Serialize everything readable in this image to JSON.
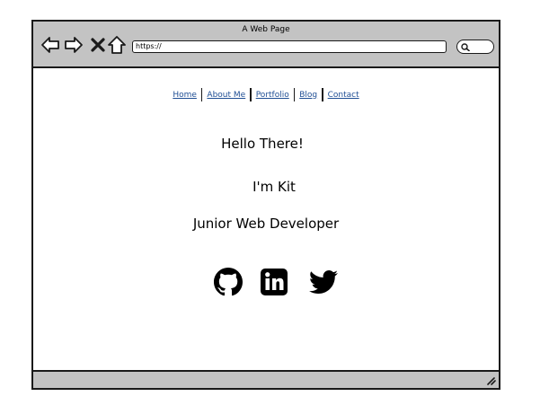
{
  "window": {
    "title": "A Web Page"
  },
  "toolbar": {
    "url": "https://",
    "icons": [
      "back-arrow-icon",
      "forward-arrow-icon",
      "stop-icon",
      "home-icon",
      "search-icon"
    ]
  },
  "nav": {
    "items": [
      {
        "label": "Home"
      },
      {
        "label": "About Me"
      },
      {
        "label": "Portfolio"
      },
      {
        "label": "Blog"
      },
      {
        "label": "Contact"
      }
    ],
    "link_color": "#1f4e94"
  },
  "main": {
    "greeting": "Hello There!",
    "name": "I'm Kit",
    "role": "Junior Web Developer"
  },
  "social": {
    "icons": [
      "github-icon",
      "linkedin-icon",
      "twitter-icon"
    ]
  },
  "colors": {
    "chrome": "#c3c3c3",
    "border": "#1a1a1a",
    "background": "#ffffff"
  }
}
